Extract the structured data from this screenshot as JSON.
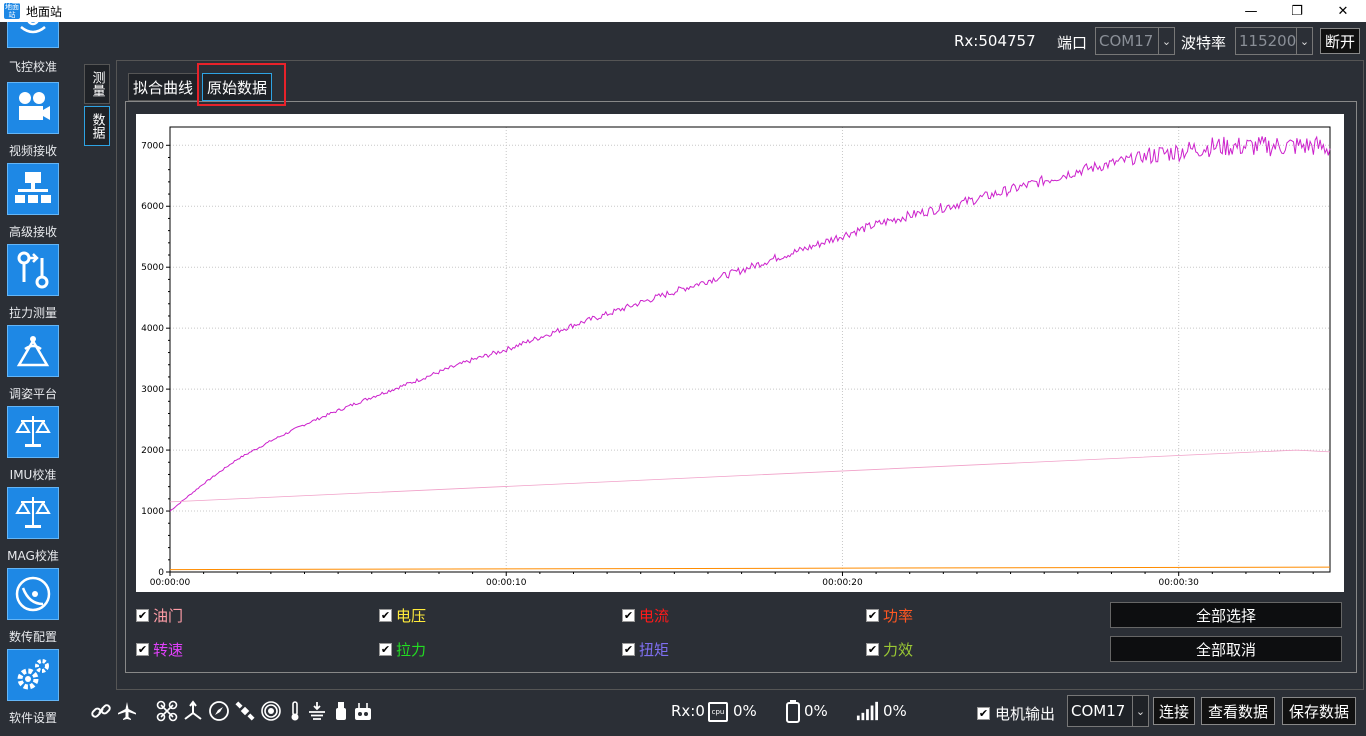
{
  "window": {
    "title": "地面站",
    "app_icon_text": "地面站",
    "minimize": "—",
    "maximize": "❐",
    "close": "✕"
  },
  "sidebar": {
    "items": [
      {
        "label": "飞控校准",
        "icon": "flight-control-calibration-icon"
      },
      {
        "label": "视频接收",
        "icon": "video-camera-icon"
      },
      {
        "label": "高级接收",
        "icon": "network-tree-icon"
      },
      {
        "label": "拉力测量",
        "icon": "tension-measure-icon"
      },
      {
        "label": "调姿平台",
        "icon": "attitude-platform-icon"
      },
      {
        "label": "IMU校准",
        "icon": "balance-scale-icon"
      },
      {
        "label": "MAG校准",
        "icon": "balance-scale-icon"
      },
      {
        "label": "数传配置",
        "icon": "satellite-dish-icon"
      },
      {
        "label": "软件设置",
        "icon": "gears-icon"
      }
    ]
  },
  "vtabs": [
    {
      "label": "测量"
    },
    {
      "label": "数据"
    }
  ],
  "topbar": {
    "rx": "Rx:504757",
    "port_label": "端口",
    "port_value": "COM17",
    "baud_label": "波特率",
    "baud_value": "115200",
    "disconnect": "断开"
  },
  "tabs": {
    "fit": "拟合曲线",
    "raw": "原始数据"
  },
  "legend": [
    {
      "label": "油门",
      "color": "#ff9da7"
    },
    {
      "label": "电压",
      "color": "#ffeb3b"
    },
    {
      "label": "电流",
      "color": "#ff1a1a"
    },
    {
      "label": "功率",
      "color": "#ff5722"
    },
    {
      "label": "转速",
      "color": "#e040fb"
    },
    {
      "label": "拉力",
      "color": "#22dd22"
    },
    {
      "label": "扭矩",
      "color": "#7e6ff0"
    },
    {
      "label": "力效",
      "color": "#9bc934"
    }
  ],
  "buttons": {
    "select_all": "全部选择",
    "deselect_all": "全部取消"
  },
  "statusbar": {
    "rx": "Rx:0",
    "cpu_badge": "cpu",
    "cpu": "0%",
    "battery": "0%",
    "signal": "0%",
    "motor_output": "电机输出",
    "port": "COM17",
    "connect": "连接",
    "view_data": "查看数据",
    "save_data": "保存数据"
  },
  "chart_data": {
    "type": "line",
    "x_ticks": [
      "00:00:00",
      "00:00:10",
      "00:00:20",
      "00:00:30"
    ],
    "x_range_seconds": [
      0,
      34.5
    ],
    "ylim": [
      0,
      7300
    ],
    "y_ticks": [
      0,
      1000,
      2000,
      3000,
      4000,
      5000,
      6000,
      7000
    ],
    "grid": true,
    "series": [
      {
        "color": "#cc22cc",
        "x": [
          0,
          1,
          2,
          3,
          4,
          5,
          6,
          7,
          8,
          9,
          10,
          11,
          12,
          13,
          14,
          15,
          16,
          17,
          18,
          19,
          20,
          21,
          22,
          23,
          24,
          25,
          26,
          27,
          28,
          29,
          30,
          31,
          32,
          33,
          34,
          34.5
        ],
        "y": [
          1000,
          1450,
          1850,
          2150,
          2420,
          2650,
          2870,
          3070,
          3280,
          3480,
          3650,
          3850,
          4050,
          4230,
          4420,
          4600,
          4780,
          4950,
          5150,
          5320,
          5520,
          5700,
          5850,
          5980,
          6120,
          6270,
          6420,
          6580,
          6700,
          6820,
          6900,
          6980,
          6980,
          6990,
          6990,
          6950
        ]
      },
      {
        "color": "#f0a0c8",
        "x": [
          0,
          33.5,
          34.5
        ],
        "y": [
          1150,
          2000,
          1970
        ]
      },
      {
        "color": "#ff8c00",
        "x": [
          0,
          34.5
        ],
        "y": [
          40,
          80
        ]
      }
    ]
  }
}
